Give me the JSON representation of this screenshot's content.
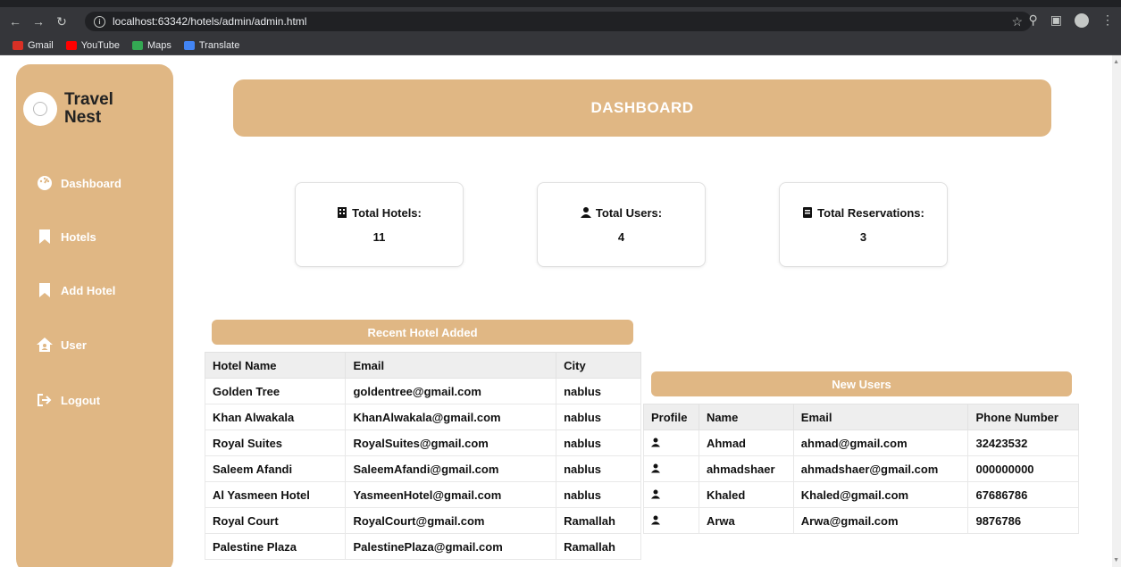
{
  "browser": {
    "url": "localhost:63342/hotels/admin/admin.html",
    "bookmarks": [
      {
        "label": "Gmail",
        "color": "#d93025"
      },
      {
        "label": "YouTube",
        "color": "#ff0000"
      },
      {
        "label": "Maps",
        "color": "#34a853"
      },
      {
        "label": "Translate",
        "color": "#4285f4"
      }
    ]
  },
  "brand": {
    "line1": "Travel",
    "line2": "Nest"
  },
  "sidebar": {
    "items": [
      {
        "label": "Dashboard",
        "icon": "gauge-icon"
      },
      {
        "label": "Hotels",
        "icon": "bookmark-icon"
      },
      {
        "label": "Add Hotel",
        "icon": "bookmark-icon"
      },
      {
        "label": "User",
        "icon": "house-user-icon"
      },
      {
        "label": "Logout",
        "icon": "logout-icon"
      }
    ]
  },
  "header": {
    "title": "DASHBOARD"
  },
  "stats": [
    {
      "label": "Total Hotels:",
      "value": "11",
      "icon": "building-icon"
    },
    {
      "label": "Total Users:",
      "value": "4",
      "icon": "user-icon"
    },
    {
      "label": "Total Reservations:",
      "value": "3",
      "icon": "receipt-icon"
    }
  ],
  "recent_hotels": {
    "title": "Recent Hotel Added",
    "columns": [
      "Hotel Name",
      "Email",
      "City"
    ],
    "rows": [
      [
        "Golden Tree",
        "goldentree@gmail.com",
        "nablus"
      ],
      [
        "Khan Alwakala",
        "KhanAlwakala@gmail.com",
        "nablus"
      ],
      [
        "Royal Suites",
        "RoyalSuites@gmail.com",
        "nablus"
      ],
      [
        "Saleem Afandi",
        "SaleemAfandi@gmail.com",
        "nablus"
      ],
      [
        "Al Yasmeen Hotel",
        "YasmeenHotel@gmail.com",
        "nablus"
      ],
      [
        "Royal Court",
        "RoyalCourt@gmail.com",
        "Ramallah"
      ],
      [
        "Palestine Plaza",
        "PalestinePlaza@gmail.com",
        "Ramallah"
      ]
    ]
  },
  "new_users": {
    "title": "New Users",
    "columns": [
      "Profile",
      "Name",
      "Email",
      "Phone Number"
    ],
    "rows": [
      [
        "Ahmad",
        "ahmad@gmail.com",
        "32423532"
      ],
      [
        "ahmadshaer",
        "ahmadshaer@gmail.com",
        "000000000"
      ],
      [
        "Khaled",
        "Khaled@gmail.com",
        "67686786"
      ],
      [
        "Arwa",
        "Arwa@gmail.com",
        "9876786"
      ]
    ]
  },
  "colors": {
    "accent": "#e0b784"
  }
}
